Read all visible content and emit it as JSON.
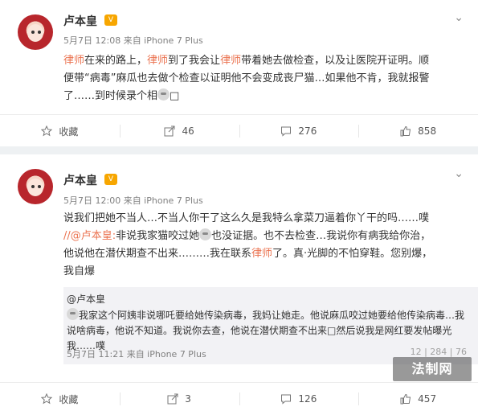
{
  "post1": {
    "author": "卢本皇",
    "meta": "5月7日 12:08 来自 iPhone 7 Plus",
    "line1": [
      {
        "t": "律师",
        "hl": true
      },
      {
        "t": "在来的路上，",
        "hl": false
      },
      {
        "t": "律师",
        "hl": true
      },
      {
        "t": "到了我会让",
        "hl": false
      },
      {
        "t": "律师",
        "hl": true
      },
      {
        "t": "带着她去做检查，以及让医院开证明。顺",
        "hl": false
      }
    ],
    "line2": "便带“病毒”麻瓜也去做个检查以证明他不会变成丧尸猫…如果他不肯，我就报警",
    "line3_before": "了……到时候录个相",
    "line3_after": "□",
    "repost_count": "46",
    "comment_count": "276",
    "like_count": "858",
    "repost_label": "收藏"
  },
  "post2": {
    "author": "卢本皇",
    "meta": "5月7日 12:00 来自 iPhone 7 Plus",
    "line1": "说我们把她不当人…不当人你干了这么久是我特么拿菜刀逼着你丫干的吗……噗",
    "line2_mention": "//@卢本皇:",
    "line2_rest_before": "非说我家猫咬过她",
    "line2_rest_after": "也没证据。也不去检查…我说你有病我给你治，",
    "line3_before": "他说他在潜伏期查不出来………我在联系",
    "line3_hl": "律师",
    "line3_after": "了。真·光脚的不怕穿鞋。您别爆，",
    "line4": "我自爆",
    "quote": {
      "name": "@卢本皇",
      "line1": "我家这个阿姨非说哪吒要给她传染病毒，我妈让她走。他说麻瓜咬过她要给他传染病毒…我",
      "line2": "说啥病毒，他说不知道。我说你去查，他说在潜伏期查不出来□然后说我是网红要发帖曝光",
      "line3": "我……噗",
      "meta": "5月7日 11:21 来自 iPhone 7 Plus",
      "stats": "12  |  284  |  76"
    },
    "repost_count": "3",
    "comment_count": "126",
    "like_count": "457",
    "repost_label": "收藏"
  },
  "watermark": "法制网"
}
